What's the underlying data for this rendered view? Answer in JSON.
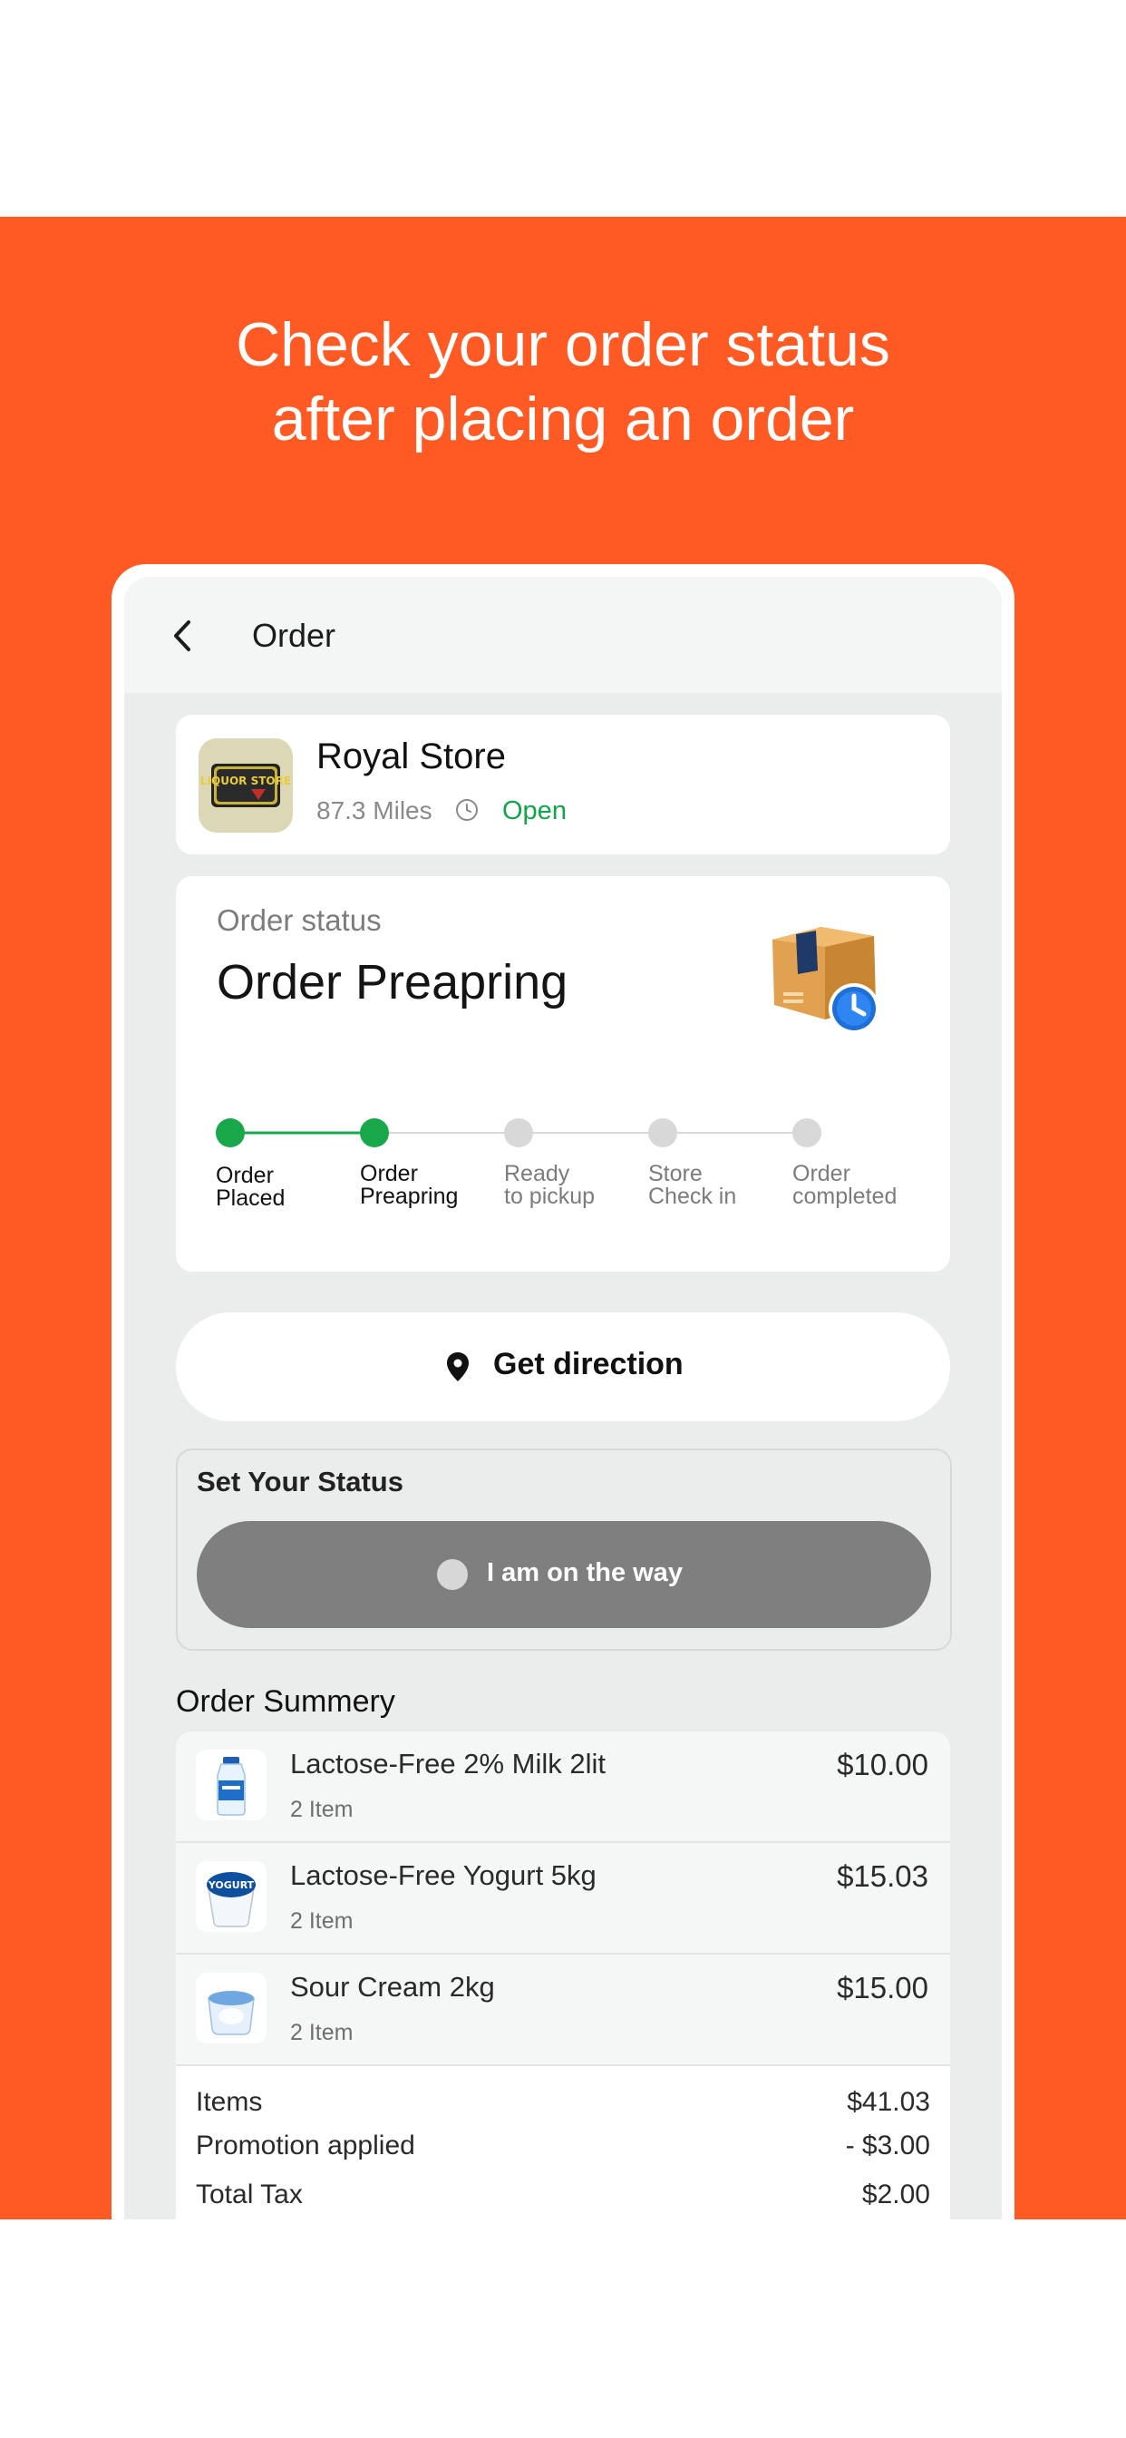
{
  "headline": {
    "line1": "Check your order status",
    "line2": "after placing an order"
  },
  "appbar": {
    "title": "Order",
    "back_icon": "chevron-left-icon"
  },
  "store": {
    "name": "Royal Store",
    "distance": "87.3 Miles",
    "status": "Open",
    "logo_text": "LIQUOR STORE",
    "status_color": "#11a54a"
  },
  "order_status": {
    "label": "Order status",
    "title": "Order Preapring",
    "current_step_index": 1,
    "steps": [
      {
        "label": "Order\nPlaced",
        "done": true
      },
      {
        "label": "Order\nPreapring",
        "done": true
      },
      {
        "label": "Ready\nto pickup",
        "done": false
      },
      {
        "label": "Store\nCheck in",
        "done": false
      },
      {
        "label": "Order\ncompleted",
        "done": false
      }
    ],
    "active_color": "#18a84a",
    "inactive_color": "#d8d8d8"
  },
  "direction_button": {
    "label": "Get direction",
    "icon": "location-pin-icon"
  },
  "set_status": {
    "title": "Set Your Status",
    "button_label": "I am on the way"
  },
  "summary": {
    "title": "Order Summery",
    "items": [
      {
        "name": "Lactose-Free 2% Milk 2lit",
        "qty": "2 Item",
        "price": "$10.00",
        "icon": "milk-bottle-icon"
      },
      {
        "name": "Lactose-Free Yogurt 5kg",
        "qty": "2 Item",
        "price": "$15.03",
        "icon": "yogurt-cup-icon",
        "badge_text": "YOGURT"
      },
      {
        "name": "Sour Cream 2kg",
        "qty": "2 Item",
        "price": "$15.00",
        "icon": "sour-cream-tub-icon"
      }
    ],
    "totals": [
      {
        "label": "Items",
        "value": "$41.03"
      },
      {
        "label": "Promotion applied",
        "value": "- $3.00"
      },
      {
        "label": "Total Tax",
        "value": "$2.00"
      }
    ]
  },
  "colors": {
    "brand": "#ff5a24",
    "screen_bg": "#ebedec",
    "button_gray": "#7f7f7f"
  }
}
